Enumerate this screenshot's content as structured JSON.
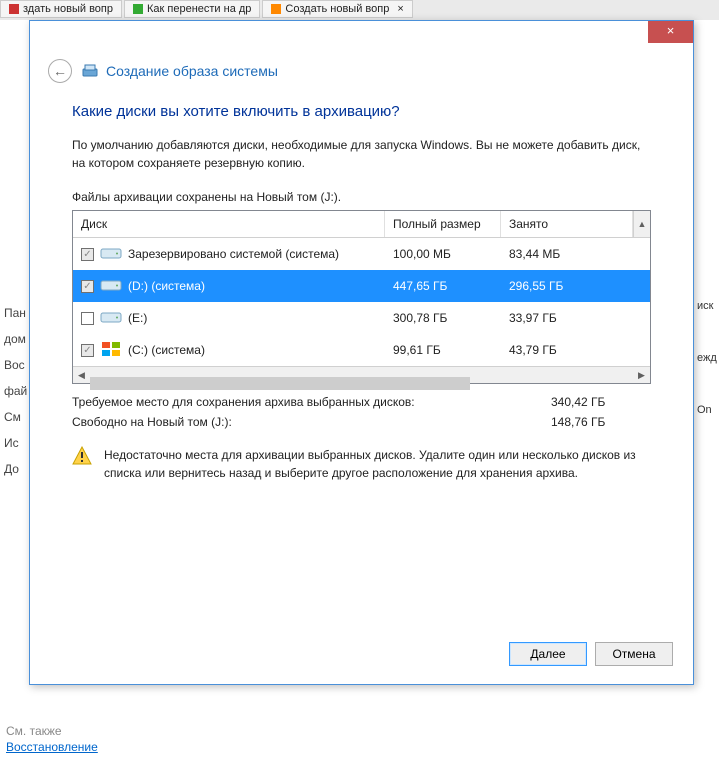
{
  "tabs": [
    {
      "label": "здать новый вопр",
      "icon_color": "#cc3333"
    },
    {
      "label": "Как перенести на др",
      "icon_color": "#33aa33"
    },
    {
      "label": "Создать новый вопр",
      "icon_color": "#ff8800",
      "closable": true
    }
  ],
  "dialog": {
    "close": "×",
    "back": "←",
    "title": "Создание образа системы",
    "question": "Какие диски вы хотите включить в архивацию?",
    "description": "По умолчанию добавляются диски, необходимые для запуска Windows. Вы не можете добавить диск, на котором сохраняете резервную копию.",
    "save_location": "Файлы архивации сохранены на Новый том (J:).",
    "columns": {
      "name": "Диск",
      "size": "Полный размер",
      "used": "Занято"
    },
    "rows": [
      {
        "checked": true,
        "disabled": true,
        "icon": "drive",
        "label": "Зарезервировано системой (система)",
        "size": "100,00 МБ",
        "used": "83,44 МБ",
        "selected": false
      },
      {
        "checked": true,
        "disabled": true,
        "icon": "drive",
        "label": "(D:) (система)",
        "size": "447,65 ГБ",
        "used": "296,55 ГБ",
        "selected": true
      },
      {
        "checked": false,
        "disabled": false,
        "icon": "drive",
        "label": "(E:)",
        "size": "300,78 ГБ",
        "used": "33,97 ГБ",
        "selected": false
      },
      {
        "checked": true,
        "disabled": true,
        "icon": "windows",
        "label": "(C:) (система)",
        "size": "99,61 ГБ",
        "used": "43,79 ГБ",
        "selected": false
      }
    ],
    "summary": {
      "required_label": "Требуемое место для сохранения архива выбранных дисков:",
      "required_value": "340,42 ГБ",
      "free_label": "Свободно на Новый том (J:):",
      "free_value": "148,76 ГБ"
    },
    "warning": "Недостаточно места для архивации выбранных дисков. Удалите один или несколько дисков из списка или вернитесь назад и выберите другое расположение для хранения архива.",
    "buttons": {
      "next": "Далее",
      "cancel": "Отмена"
    }
  },
  "bg": {
    "side": [
      "Пан",
      "дом",
      "Вос",
      "фай",
      "См",
      "Ис",
      "До"
    ],
    "rightfrag": [
      "иск",
      "ежд",
      "On"
    ],
    "seealso": "См. также",
    "recovery": "Восстановление"
  }
}
